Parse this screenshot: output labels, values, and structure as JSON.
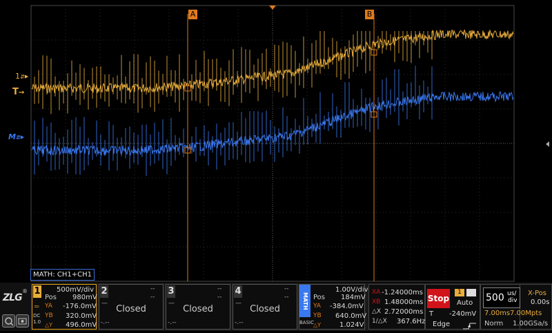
{
  "colors": {
    "ch1": "#e8ad3c",
    "math": "#3a78f0",
    "cursor": "#e07a1c",
    "grid": "#3a3a3a",
    "stop": "#d0141a"
  },
  "markers": {
    "cursor_a": "A",
    "cursor_b": "B",
    "ch1_marker": "1",
    "trigger_marker": "T",
    "math_marker": "M"
  },
  "math_source": "MATH: CH1+CH1",
  "brand": "ZLG",
  "ch1": {
    "num": "1",
    "scale": "500mV/div",
    "pos_label": "Pos",
    "pos": "980mV",
    "ya_label": "YA",
    "ya": "-176.0mV",
    "yb_label": "YB",
    "yb": "320.0mV",
    "dy_label": "△Y",
    "dy": "496.0mV",
    "coupling": "DC",
    "probe": "1.0"
  },
  "ch2": {
    "num": "2",
    "status": "Closed",
    "top_dash": "--",
    "mid_dash": "--",
    "low_dash": "-.--"
  },
  "ch3": {
    "num": "3",
    "status": "Closed",
    "top_dash": "--",
    "mid_dash": "--",
    "low_dash": "-.--"
  },
  "ch4": {
    "num": "4",
    "status": "Closed",
    "top_dash": "--",
    "mid_dash": "--",
    "low_dash": "-.--"
  },
  "math": {
    "tag": "MATH",
    "sub": "BASIC",
    "scale": "1.00V/div",
    "pos_label": "Pos",
    "pos": "184mV",
    "ya_label": "YA",
    "ya": "-384.0mV",
    "yb_label": "YB",
    "yb": "640.0mV",
    "dy_label": "△Y",
    "dy": "1.024V"
  },
  "cursors": {
    "xa_label": "XA",
    "xa": "-1.24000ms",
    "xb_label": "XB",
    "xb": "1.48000ms",
    "dx_label": "△X",
    "dx": "2.72000ms",
    "inv_label": "1/△X",
    "inv": "367.6Hz"
  },
  "run": {
    "state": "Stop",
    "trigger_source": "1",
    "mode": "Auto",
    "trig_label": "T",
    "trig_level": "-240mV",
    "trig_type": "Edge"
  },
  "timebase": {
    "value": "500",
    "unit_top": "us/",
    "unit_bottom": "div",
    "span": "7.00ms",
    "mem": "7.00Mpts",
    "acq": "Norm",
    "rate": "1.00GSa/s"
  },
  "xpos": {
    "label": "X-Pos",
    "value": "0.00s"
  }
}
